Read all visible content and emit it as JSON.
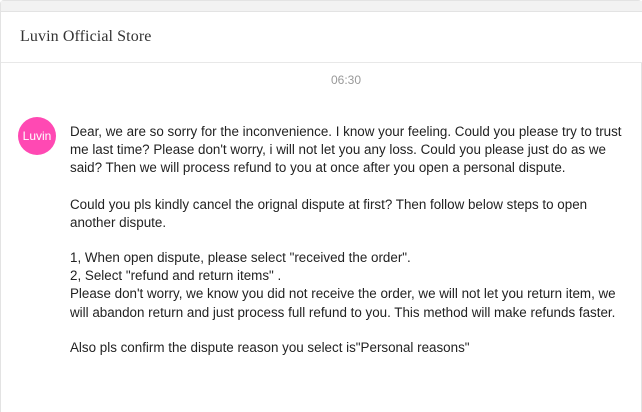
{
  "header": {
    "store_name": "Luvin Official Store"
  },
  "chat": {
    "timestamp": "06:30",
    "avatar_label": "Luvin",
    "message": {
      "p1": "Dear, we are so sorry for the inconvenience. I know your feeling. Could you please try to trust me last time? Please don't worry, i will not let you any loss. Could you please just do as we said? Then we will process refund to you at once after you open a personal dispute.",
      "p2": "Could you pls kindly cancel the orignal dispute at first? Then follow below steps to open another dispute.",
      "step1": "1, When open dispute, please select \"received the order\".",
      "step2": "2, Select \"refund and return items\" .",
      "p3": "Please don't worry, we know you did not receive the order, we will not let you return item, we will abandon return and just process full refund to you. This method will make refunds faster.",
      "p4": "Also pls confirm the dispute reason you select is\"Personal reasons\""
    }
  }
}
